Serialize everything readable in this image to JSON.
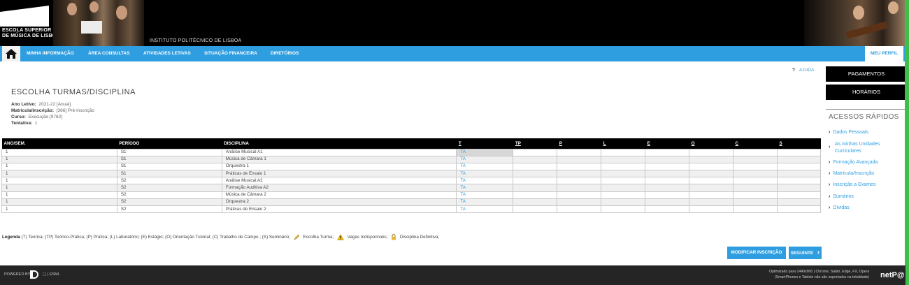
{
  "header": {
    "school_name_line1": "ESCOLA SUPERIOR",
    "school_name_line2": "DE MÚSICA DE LISBOA",
    "institute": "INSTITUTO POLITÉCNICO DE LISBOA"
  },
  "nav": {
    "home_icon": "home-icon",
    "items": [
      "MINHA INFORMAÇÃO",
      "ÁREA CONSULTAS",
      "ATIVIDADES LETIVAS",
      "SITUAÇÃO FINANCEIRA",
      "DIRETÓRIOS"
    ],
    "profile": "MEU PERFIL"
  },
  "help": {
    "mark": "?",
    "label": "AJUDA"
  },
  "page_title": "ESCOLHA TURMAS/DISCIPLINA",
  "info": {
    "ano_letivo_label": "Ano Letivo:",
    "ano_letivo_value": "2021-22 [Anual]",
    "matricula_label": "Matrícula/Inscrição:",
    "matricula_value": "[366] Pré-inscrição",
    "curso_label": "Curso:",
    "curso_value": "Execução [9782]",
    "tentativa_label": "Tentativa:",
    "tentativa_value": "1"
  },
  "table": {
    "headers": [
      "ANO/SEM.",
      "PERÍODO",
      "DISCIPLINA",
      "T",
      "TP",
      "P",
      "L",
      "E",
      "O",
      "C",
      "S"
    ],
    "rows": [
      {
        "ano": "1",
        "periodo": "S1",
        "disciplina": "Análise Musical A1",
        "t": "TA"
      },
      {
        "ano": "1",
        "periodo": "S1",
        "disciplina": "Música de Câmara 1",
        "t": "TA"
      },
      {
        "ano": "1",
        "periodo": "S1",
        "disciplina": "Orquestra 1",
        "t": "TA"
      },
      {
        "ano": "1",
        "periodo": "S1",
        "disciplina": "Práticas de Ensaio 1",
        "t": "TA"
      },
      {
        "ano": "1",
        "periodo": "S2",
        "disciplina": "Análise Musical A2",
        "t": "TA"
      },
      {
        "ano": "1",
        "periodo": "S2",
        "disciplina": "Formação Auditiva A2",
        "t": "TA"
      },
      {
        "ano": "1",
        "periodo": "S2",
        "disciplina": "Música de Câmara 2",
        "t": "TA"
      },
      {
        "ano": "1",
        "periodo": "S2",
        "disciplina": "Orquestra 2",
        "t": "TA"
      },
      {
        "ano": "1",
        "periodo": "S2",
        "disciplina": "Práticas de Ensaio 2",
        "t": "TA"
      }
    ]
  },
  "legend": {
    "label": "Legenda",
    "text": "(T) Teórica; (TP) Teórico-Prática; (P) Prática; (L) Laboratório; (E) Estágio; (O) Orientação Tutorial; (C) Trabalho de Campo ; (S) Seminário;",
    "escolha": "Escolha Turma;",
    "vagas": "Vagas Indisponíveis;",
    "definitiva": "Disciplina Definitiva;"
  },
  "buttons": {
    "modify": "MODIFICAR INSCRIÇÃO",
    "next": "SEGUINTE",
    "next_icon": "›"
  },
  "sidebar": {
    "pagamentos": "PAGAMENTOS",
    "horarios": "HORÁRIOS",
    "quick_title": "ACESSOS RÁPIDOS",
    "links": [
      "Dados Pessoais",
      "As minhas Unidades Curriculares",
      "Formação Avançada",
      "Matrícula/Inscrição",
      "Inscrição a Exames",
      "Sumários",
      "Dívidas"
    ]
  },
  "footer": {
    "powered": "POWERED BY",
    "brand": "ESML",
    "opt_line1": "Optimizado para 1440x900 | Chrome, Safari, Edge, FX, Opera",
    "opt_line2": "(SmartPhones e Tablets não são suportados na totalidade)",
    "netpa": "netP@"
  },
  "colors": {
    "accent": "#2f9ee0",
    "header_bg": "#000000",
    "footer_bg": "#252525"
  }
}
